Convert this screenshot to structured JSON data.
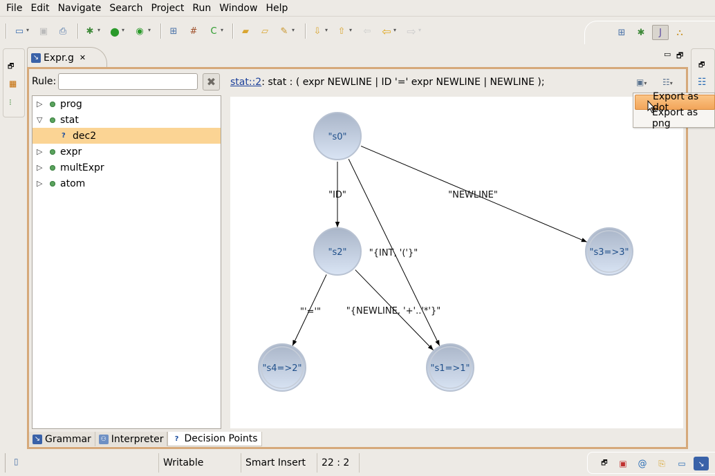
{
  "menu": [
    "File",
    "Edit",
    "Navigate",
    "Search",
    "Project",
    "Run",
    "Window",
    "Help"
  ],
  "menu_mnemonics": [
    "F",
    "E",
    "N",
    "a",
    "P",
    "R",
    "W",
    "H"
  ],
  "toolbar": {
    "icons": [
      "new-wizard-icon",
      "save-icon",
      "print-icon",
      "debug-icon",
      "run-icon",
      "external-tools-icon",
      "new-folder-icon",
      "new-package-icon",
      "new-class-icon",
      "open-type-icon",
      "open-resource-icon",
      "search-icon",
      "next-annotation-icon",
      "previous-annotation-icon",
      "last-edit-icon",
      "back-icon",
      "forward-icon"
    ],
    "perspectives": [
      "open-perspective-icon",
      "debug-perspective-icon",
      "java-perspective-icon",
      "hierarchy-perspective-icon"
    ]
  },
  "editor": {
    "tab_title": "Expr.g",
    "rule_label": "Rule:",
    "rule_value": "",
    "tree": [
      {
        "label": "prog",
        "expanded": false
      },
      {
        "label": "stat",
        "expanded": true
      },
      {
        "label": "dec2",
        "child": true,
        "selected": true
      },
      {
        "label": "expr",
        "expanded": false
      },
      {
        "label": "multExpr",
        "expanded": false
      },
      {
        "label": "atom",
        "expanded": false
      }
    ],
    "decision": {
      "link": "stat::2",
      "text": ": stat : ( expr NEWLINE | ID '=' expr NEWLINE | NEWLINE );"
    },
    "popup": {
      "items": [
        "Export as dot",
        "Export as png"
      ],
      "highlighted": "Export as dot"
    },
    "graph": {
      "nodes": [
        {
          "id": "s0",
          "label": "\"s0\"",
          "final": false
        },
        {
          "id": "s2",
          "label": "\"s2\"",
          "final": false
        },
        {
          "id": "s3",
          "label": "\"s3=>3\"",
          "final": true
        },
        {
          "id": "s4",
          "label": "\"s4=>2\"",
          "final": true
        },
        {
          "id": "s1",
          "label": "\"s1=>1\"",
          "final": true
        }
      ],
      "edges": [
        {
          "from": "s0",
          "to": "s2",
          "label": "\"ID\""
        },
        {
          "from": "s0",
          "to": "s3",
          "label": "\"NEWLINE\""
        },
        {
          "from": "s0",
          "to": "s1",
          "label": "\"{INT, '('}\""
        },
        {
          "from": "s2",
          "to": "s4",
          "label": "\"'='\""
        },
        {
          "from": "s2",
          "to": "s1",
          "label": "\"{NEWLINE, '+'..'*'}\""
        }
      ]
    },
    "bottom_tabs": [
      {
        "label": "Grammar",
        "icon": "grammar-icon",
        "active": false
      },
      {
        "label": "Interpreter",
        "icon": "interpreter-icon",
        "active": false
      },
      {
        "label": "Decision Points",
        "icon": "question-icon",
        "active": true
      }
    ]
  },
  "status": {
    "writable": "Writable",
    "insert_mode": "Smart Insert",
    "position": "22 : 2"
  }
}
